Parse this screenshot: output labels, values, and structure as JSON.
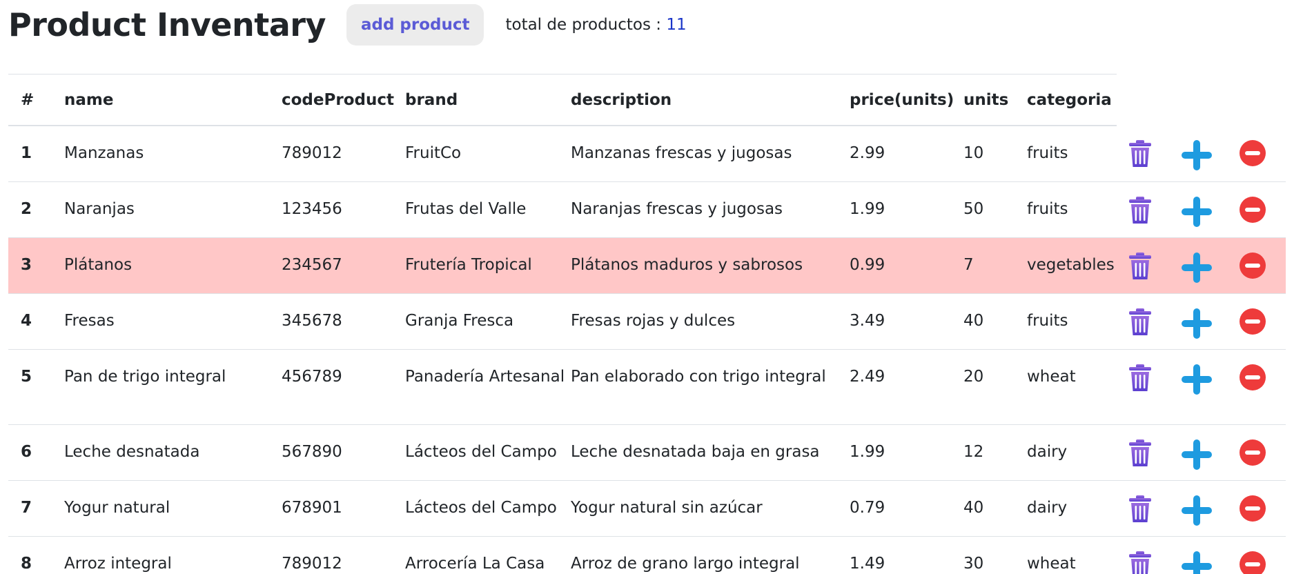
{
  "header": {
    "title": "Product Inventary",
    "add_label": "add product",
    "total_label": "total de productos :",
    "total_count": "11"
  },
  "table": {
    "columns": [
      "#",
      "name",
      "codeProduct",
      "brand",
      "description",
      "price(units)",
      "units",
      "categoria"
    ],
    "rows": [
      {
        "num": "1",
        "name": "Manzanas",
        "code": "789012",
        "brand": "FruitCo",
        "description": "Manzanas frescas y jugosas",
        "price": "2.99",
        "units": "10",
        "category": "fruits"
      },
      {
        "num": "2",
        "name": "Naranjas",
        "code": "123456",
        "brand": "Frutas del Valle",
        "description": "Naranjas frescas y jugosas",
        "price": "1.99",
        "units": "50",
        "category": "fruits"
      },
      {
        "num": "3",
        "name": "Plátanos",
        "code": "234567",
        "brand": "Frutería Tropical",
        "description": "Plátanos maduros y sabrosos",
        "price": "0.99",
        "units": "7",
        "category": "vegetables",
        "highlighted": true
      },
      {
        "num": "4",
        "name": "Fresas",
        "code": "345678",
        "brand": "Granja Fresca",
        "description": "Fresas rojas y dulces",
        "price": "3.49",
        "units": "40",
        "category": "fruits"
      },
      {
        "num": "5",
        "name": "Pan de trigo integral",
        "code": "456789",
        "brand": "Panadería Artesanal",
        "description": "Pan elaborado con trigo integral",
        "price": "2.49",
        "units": "20",
        "category": "wheat"
      },
      {
        "num": "6",
        "name": "Leche desnatada",
        "code": "567890",
        "brand": "Lácteos del Campo",
        "description": "Leche desnatada baja en grasa",
        "price": "1.99",
        "units": "12",
        "category": "dairy"
      },
      {
        "num": "7",
        "name": "Yogur natural",
        "code": "678901",
        "brand": "Lácteos del Campo",
        "description": "Yogur natural sin azúcar",
        "price": "0.79",
        "units": "40",
        "category": "dairy"
      },
      {
        "num": "8",
        "name": "Arroz integral",
        "code": "789012",
        "brand": "Arrocería La Casa",
        "description": "Arroz de grano largo integral",
        "price": "1.49",
        "units": "30",
        "category": "wheat"
      }
    ]
  },
  "icons": {
    "delete": "trash-icon",
    "increase": "plus-icon",
    "decrease": "minus-circle-icon"
  },
  "colors": {
    "accent": "#5b5bd6",
    "highlight_row": "#ffc7c7",
    "trash": "#7b4fd6",
    "plus": "#1e9be0",
    "minus": "#ee3b3b",
    "total_count": "#1a35c8"
  }
}
